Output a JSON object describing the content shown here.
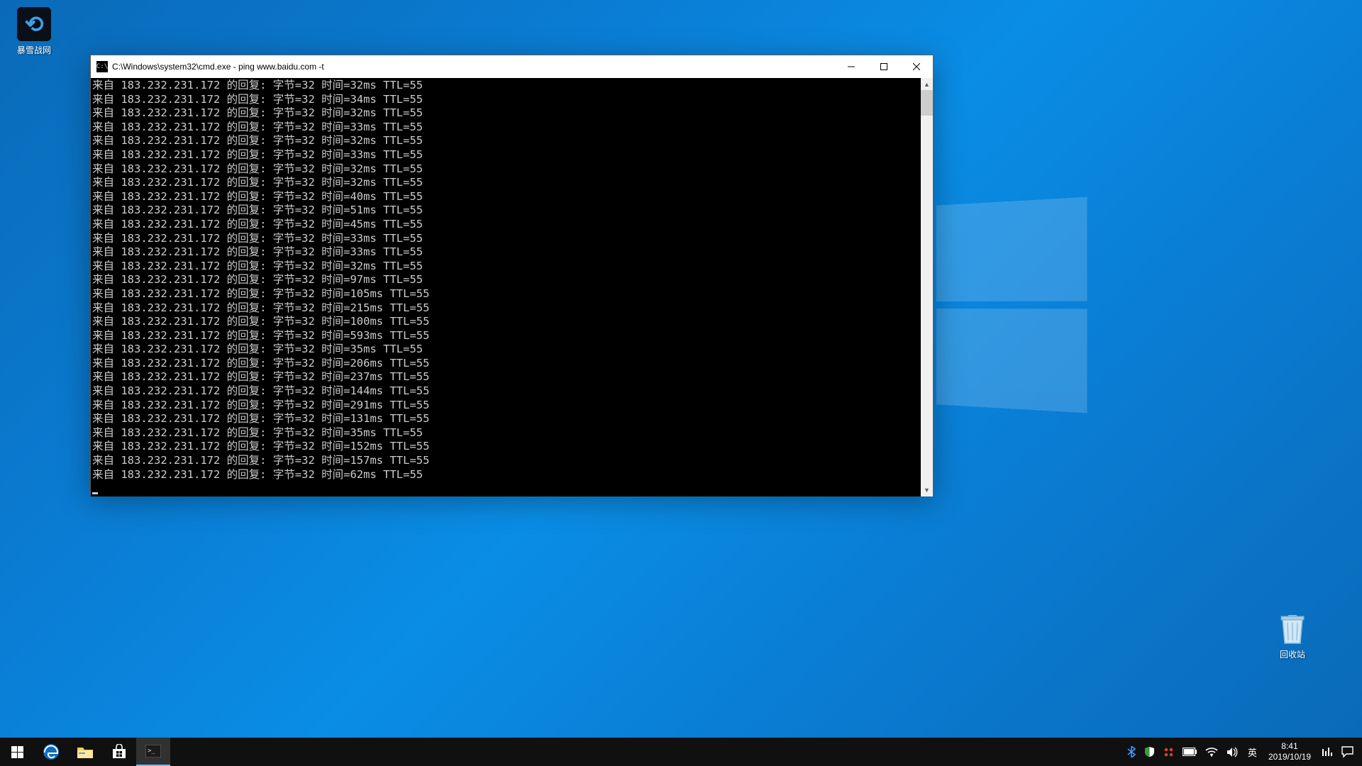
{
  "desktop": {
    "icons": {
      "blizzard": {
        "label": "暴雪战网",
        "glyph": "⟲"
      },
      "recycle": {
        "label": "回收站"
      }
    }
  },
  "cmd": {
    "title": "C:\\Windows\\system32\\cmd.exe - ping  www.baidu.com -t",
    "icon_glyph": "C:\\",
    "ip": "183.232.231.172",
    "bytes": "32",
    "ttl": "55",
    "prefix": "来自 ",
    "reply": " 的回复: 字节=",
    "time_label": " 时间=",
    "ttl_label": " TTL=",
    "times_ms": [
      "32",
      "34",
      "32",
      "33",
      "32",
      "33",
      "32",
      "32",
      "40",
      "51",
      "45",
      "33",
      "33",
      "32",
      "97",
      "105",
      "215",
      "100",
      "593",
      "35",
      "206",
      "237",
      "144",
      "291",
      "131",
      "35",
      "152",
      "157",
      "62"
    ]
  },
  "taskbar": {
    "start": "start",
    "apps": {
      "edge": "Edge",
      "explorer": "File Explorer",
      "store": "Microsoft Store",
      "cmd": "Command Prompt"
    },
    "tray": {
      "bluetooth": "bluetooth",
      "security": "windows-security",
      "app_red": "background-app",
      "battery": "battery",
      "wifi": "wifi",
      "volume": "volume",
      "ime": "英"
    },
    "clock": {
      "time": "8:41",
      "date": "2019/10/19"
    },
    "extra1": "overlay-1",
    "extra2": "action-center"
  }
}
